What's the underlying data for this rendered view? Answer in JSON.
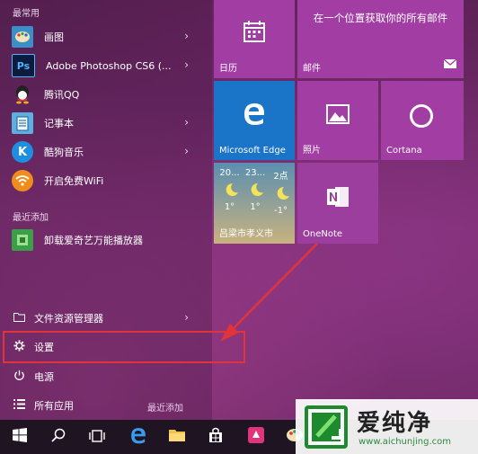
{
  "left": {
    "frequent_label": "最常用",
    "frequent": [
      {
        "label": "画图",
        "icon": "paint-icon",
        "chevron": true
      },
      {
        "label": "Adobe Photoshop CS6 (...",
        "icon": "photoshop-icon",
        "chevron": true
      },
      {
        "label": "腾讯QQ",
        "icon": "qq-icon",
        "chevron": false
      },
      {
        "label": "记事本",
        "icon": "notepad-icon",
        "chevron": true
      },
      {
        "label": "酷狗音乐",
        "icon": "kugou-icon",
        "chevron": true
      },
      {
        "label": "开启免费WiFi",
        "icon": "wifi-icon",
        "chevron": false
      }
    ],
    "recent_label": "最近添加",
    "recent": [
      {
        "label": "卸载爱奇艺万能播放器",
        "icon": "uninstall-icon"
      }
    ],
    "system": {
      "explorer_label": "文件资源管理器",
      "settings_label": "设置",
      "power_label": "电源",
      "all_apps_label": "所有应用",
      "recent_added_label": "最近添加"
    }
  },
  "tiles": {
    "calendar": {
      "label": "日历"
    },
    "mail": {
      "label": "邮件",
      "message": "在一个位置获取你的所有邮件"
    },
    "edge": {
      "label": "Microsoft Edge"
    },
    "photos": {
      "label": "照片"
    },
    "cortana": {
      "label": "Cortana"
    },
    "weather": {
      "label": "吕梁市孝义市",
      "days": [
        {
          "day": "20...",
          "temp": "1°"
        },
        {
          "day": "23...",
          "temp": "1°"
        },
        {
          "day": "2点",
          "temp": "-1°"
        }
      ]
    },
    "onenote": {
      "label": "OneNote"
    }
  },
  "watermark": {
    "brand": "爱纯净",
    "url": "www.aichunjing.com"
  },
  "colors": {
    "tile_purple": "#a23da4",
    "tile_blue": "#1a74c8",
    "highlight_red": "#e0343a"
  }
}
